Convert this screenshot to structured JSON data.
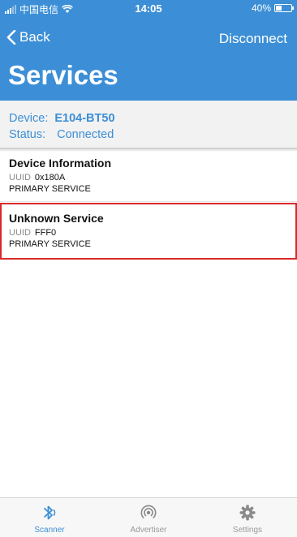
{
  "status_bar": {
    "carrier": "中国电信",
    "time": "14:05",
    "battery": "40%",
    "battery_level": 0.4
  },
  "nav": {
    "back_label": "Back",
    "disconnect_label": "Disconnect"
  },
  "page": {
    "title": "Services"
  },
  "device": {
    "device_label": "Device:",
    "device_value": "E104-BT50",
    "status_label": "Status:",
    "status_value": "Connected"
  },
  "services": [
    {
      "name": "Device Information",
      "uuid_label": "UUID",
      "uuid": "0x180A",
      "type": "PRIMARY SERVICE"
    },
    {
      "name": "Unknown Service",
      "uuid_label": "UUID",
      "uuid": "FFF0",
      "type": "PRIMARY SERVICE"
    }
  ],
  "tabs": [
    {
      "label": "Scanner",
      "icon": "bluetooth-icon",
      "active": true
    },
    {
      "label": "Advertiser",
      "icon": "broadcast-icon",
      "active": false
    },
    {
      "label": "Settings",
      "icon": "gear-icon",
      "active": false
    }
  ],
  "colors": {
    "accent": "#3c8fd6",
    "highlight_border": "#d82a2a"
  }
}
